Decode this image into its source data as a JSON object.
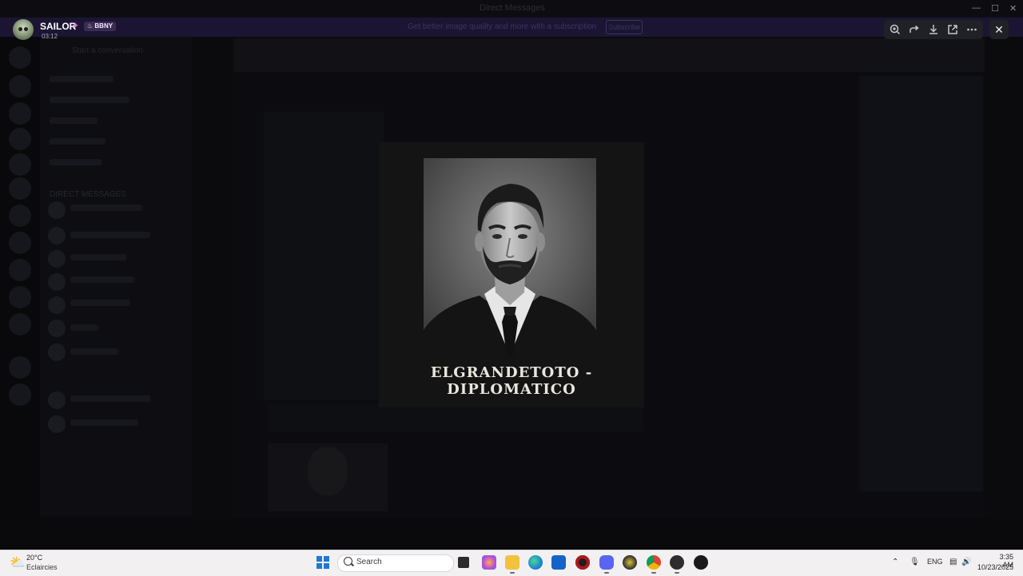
{
  "background_app": {
    "window_title": "Direct Messages",
    "banner_text": "Get better image quality and more with a subscription",
    "banner_button": "Subscribe",
    "sidebar_header": "Start a conversation",
    "sidebar_section": "DIRECT MESSAGES"
  },
  "viewer": {
    "user_name": "SAILOR",
    "user_badge": "BBNY",
    "timestamp": "03:12",
    "image_caption": "ELGRANDETOTO - DIPLOMATICO",
    "tools": [
      "zoom-in-icon",
      "forward-icon",
      "download-icon",
      "open-external-icon",
      "more-icon"
    ]
  },
  "taskbar": {
    "weather_temp": "20°C",
    "weather_condition": "Eclaircies",
    "search_placeholder": "Search",
    "language": "ENG",
    "time": "3:35 AM",
    "date": "10/23/2025"
  },
  "colors": {
    "accent": "#5865f2",
    "badge": "#3b2b52",
    "taskbar": "#f3f0f1"
  }
}
